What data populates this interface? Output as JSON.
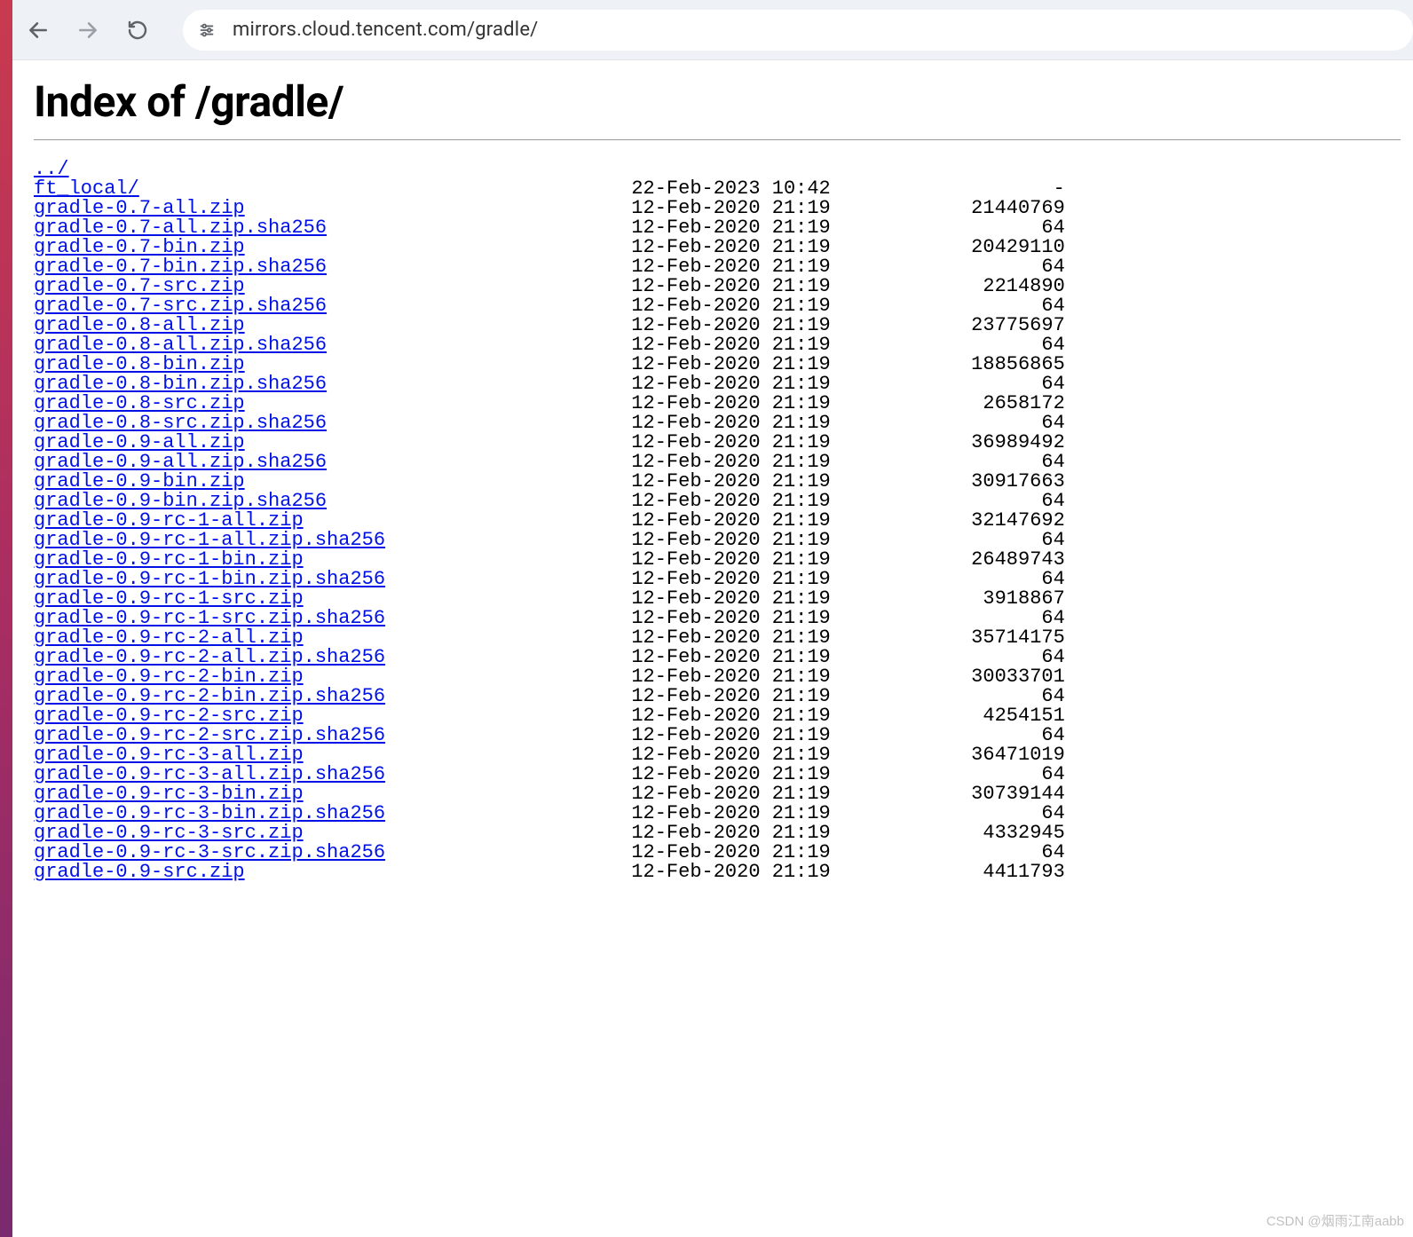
{
  "browser": {
    "url": "mirrors.cloud.tencent.com/gradle/"
  },
  "page": {
    "title": "Index of /gradle/"
  },
  "listing": {
    "parent": "../",
    "entries": [
      {
        "name": "ft_local/",
        "date": "22-Feb-2023 10:42",
        "size": "-"
      },
      {
        "name": "gradle-0.7-all.zip",
        "date": "12-Feb-2020 21:19",
        "size": "21440769"
      },
      {
        "name": "gradle-0.7-all.zip.sha256",
        "date": "12-Feb-2020 21:19",
        "size": "64"
      },
      {
        "name": "gradle-0.7-bin.zip",
        "date": "12-Feb-2020 21:19",
        "size": "20429110"
      },
      {
        "name": "gradle-0.7-bin.zip.sha256",
        "date": "12-Feb-2020 21:19",
        "size": "64"
      },
      {
        "name": "gradle-0.7-src.zip",
        "date": "12-Feb-2020 21:19",
        "size": "2214890"
      },
      {
        "name": "gradle-0.7-src.zip.sha256",
        "date": "12-Feb-2020 21:19",
        "size": "64"
      },
      {
        "name": "gradle-0.8-all.zip",
        "date": "12-Feb-2020 21:19",
        "size": "23775697"
      },
      {
        "name": "gradle-0.8-all.zip.sha256",
        "date": "12-Feb-2020 21:19",
        "size": "64"
      },
      {
        "name": "gradle-0.8-bin.zip",
        "date": "12-Feb-2020 21:19",
        "size": "18856865"
      },
      {
        "name": "gradle-0.8-bin.zip.sha256",
        "date": "12-Feb-2020 21:19",
        "size": "64"
      },
      {
        "name": "gradle-0.8-src.zip",
        "date": "12-Feb-2020 21:19",
        "size": "2658172"
      },
      {
        "name": "gradle-0.8-src.zip.sha256",
        "date": "12-Feb-2020 21:19",
        "size": "64"
      },
      {
        "name": "gradle-0.9-all.zip",
        "date": "12-Feb-2020 21:19",
        "size": "36989492"
      },
      {
        "name": "gradle-0.9-all.zip.sha256",
        "date": "12-Feb-2020 21:19",
        "size": "64"
      },
      {
        "name": "gradle-0.9-bin.zip",
        "date": "12-Feb-2020 21:19",
        "size": "30917663"
      },
      {
        "name": "gradle-0.9-bin.zip.sha256",
        "date": "12-Feb-2020 21:19",
        "size": "64"
      },
      {
        "name": "gradle-0.9-rc-1-all.zip",
        "date": "12-Feb-2020 21:19",
        "size": "32147692"
      },
      {
        "name": "gradle-0.9-rc-1-all.zip.sha256",
        "date": "12-Feb-2020 21:19",
        "size": "64"
      },
      {
        "name": "gradle-0.9-rc-1-bin.zip",
        "date": "12-Feb-2020 21:19",
        "size": "26489743"
      },
      {
        "name": "gradle-0.9-rc-1-bin.zip.sha256",
        "date": "12-Feb-2020 21:19",
        "size": "64"
      },
      {
        "name": "gradle-0.9-rc-1-src.zip",
        "date": "12-Feb-2020 21:19",
        "size": "3918867"
      },
      {
        "name": "gradle-0.9-rc-1-src.zip.sha256",
        "date": "12-Feb-2020 21:19",
        "size": "64"
      },
      {
        "name": "gradle-0.9-rc-2-all.zip",
        "date": "12-Feb-2020 21:19",
        "size": "35714175"
      },
      {
        "name": "gradle-0.9-rc-2-all.zip.sha256",
        "date": "12-Feb-2020 21:19",
        "size": "64"
      },
      {
        "name": "gradle-0.9-rc-2-bin.zip",
        "date": "12-Feb-2020 21:19",
        "size": "30033701"
      },
      {
        "name": "gradle-0.9-rc-2-bin.zip.sha256",
        "date": "12-Feb-2020 21:19",
        "size": "64"
      },
      {
        "name": "gradle-0.9-rc-2-src.zip",
        "date": "12-Feb-2020 21:19",
        "size": "4254151"
      },
      {
        "name": "gradle-0.9-rc-2-src.zip.sha256",
        "date": "12-Feb-2020 21:19",
        "size": "64"
      },
      {
        "name": "gradle-0.9-rc-3-all.zip",
        "date": "12-Feb-2020 21:19",
        "size": "36471019"
      },
      {
        "name": "gradle-0.9-rc-3-all.zip.sha256",
        "date": "12-Feb-2020 21:19",
        "size": "64"
      },
      {
        "name": "gradle-0.9-rc-3-bin.zip",
        "date": "12-Feb-2020 21:19",
        "size": "30739144"
      },
      {
        "name": "gradle-0.9-rc-3-bin.zip.sha256",
        "date": "12-Feb-2020 21:19",
        "size": "64"
      },
      {
        "name": "gradle-0.9-rc-3-src.zip",
        "date": "12-Feb-2020 21:19",
        "size": "4332945"
      },
      {
        "name": "gradle-0.9-rc-3-src.zip.sha256",
        "date": "12-Feb-2020 21:19",
        "size": "64"
      },
      {
        "name": "gradle-0.9-src.zip",
        "date": "12-Feb-2020 21:19",
        "size": "4411793"
      }
    ]
  },
  "watermark": "CSDN @烟雨江南aabb"
}
